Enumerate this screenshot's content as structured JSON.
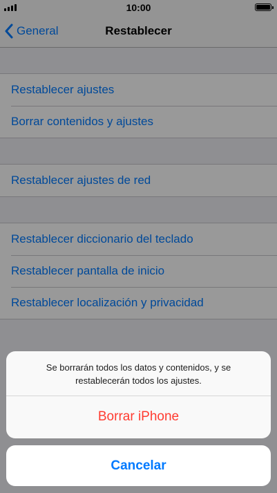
{
  "status_bar": {
    "time": "10:00"
  },
  "nav": {
    "back_label": "General",
    "title": "Restablecer"
  },
  "groups": [
    {
      "items": [
        {
          "label": "Restablecer ajustes"
        },
        {
          "label": "Borrar contenidos y ajustes"
        }
      ]
    },
    {
      "items": [
        {
          "label": "Restablecer ajustes de red"
        }
      ]
    },
    {
      "items": [
        {
          "label": "Restablecer diccionario del teclado"
        },
        {
          "label": "Restablecer pantalla de inicio"
        },
        {
          "label": "Restablecer localización y privacidad"
        }
      ]
    }
  ],
  "action_sheet": {
    "message": "Se borrarán todos los datos y contenidos, y se restablecerán todos los ajustes.",
    "destructive_label": "Borrar iPhone",
    "cancel_label": "Cancelar"
  },
  "colors": {
    "accent": "#007aff",
    "destructive": "#ff3b30"
  },
  "icons": {
    "back": "chevron-left-icon",
    "signal": "signal-icon",
    "battery": "battery-icon"
  }
}
